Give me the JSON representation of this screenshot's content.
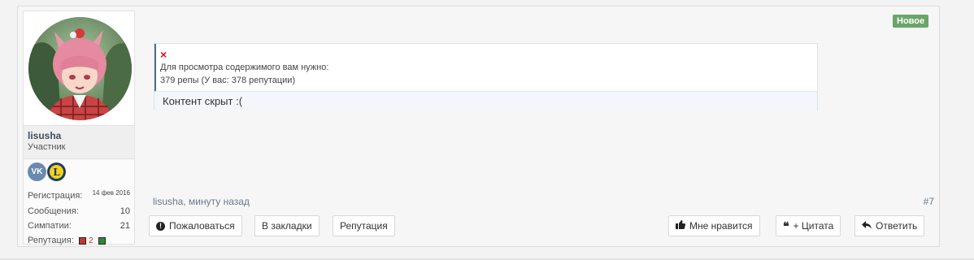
{
  "post": {
    "new_badge": "Новое",
    "number": "#7",
    "meta": "lisusha, минуту назад"
  },
  "user": {
    "name": "lisusha",
    "title": "Участник",
    "badges": [
      "vk-icon",
      "l-icon"
    ],
    "vk_label": "VK",
    "l_label": "L",
    "stats": {
      "reg_label": "Регистрация:",
      "reg_value": "14 фев 2016",
      "msgs_label": "Сообщения:",
      "msgs_value": "10",
      "likes_label": "Симпатии:",
      "likes_value": "21",
      "rep_label": "Репутация:",
      "rep_value": "2"
    },
    "rep_colors": {
      "minus": "#c0392b",
      "plus": "#2e8b2e"
    }
  },
  "hidden": {
    "close_symbol": "×",
    "line1": "Для просмотра содержимого вам нужно:",
    "line2": "379 репы (У вас: 378 репутации)",
    "content": "Контент скрыт :("
  },
  "actions": {
    "report": "Пожаловаться",
    "bookmark": "В закладки",
    "reputation": "Репутация",
    "like": "Мне нравится",
    "quote": "+ Цитата",
    "reply": "Ответить"
  },
  "colors": {
    "accent": "#536a87",
    "new": "#6aa56a",
    "close": "#d11111"
  }
}
